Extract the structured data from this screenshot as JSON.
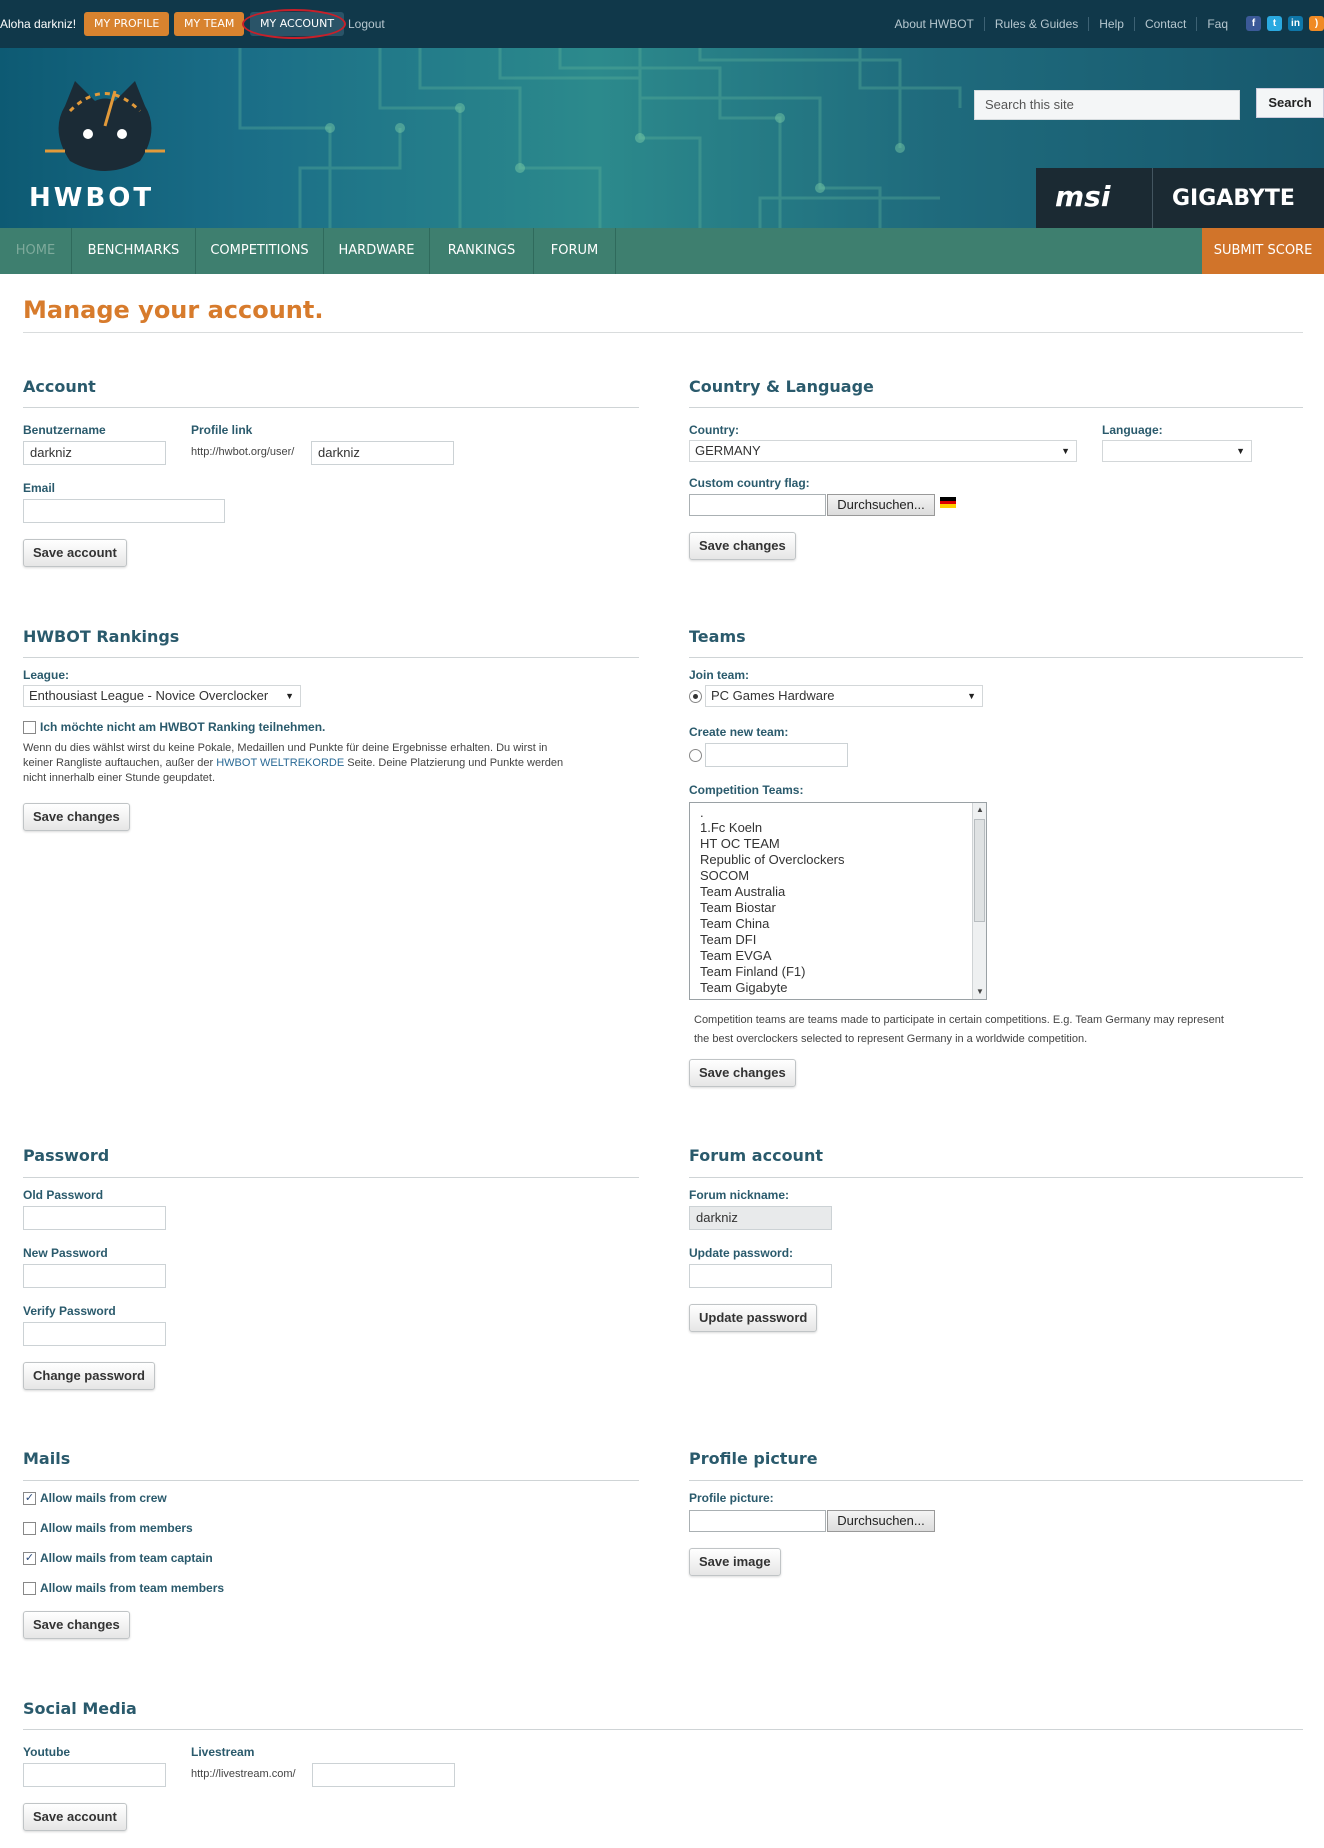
{
  "topbar": {
    "greeting": "Aloha darkniz!",
    "my_profile": "MY PROFILE",
    "my_team": "MY TEAM",
    "my_account": "MY ACCOUNT",
    "logout": "Logout",
    "links": [
      "About HWBOT",
      "Rules & Guides",
      "Help",
      "Contact",
      "Faq"
    ],
    "social_icons": [
      "facebook-icon",
      "twitter-icon",
      "linkedin-icon",
      "rss-icon"
    ]
  },
  "header": {
    "logo_text": "HWBOT",
    "search_placeholder": "Search this site",
    "search_button": "Search",
    "sponsors": [
      "msi",
      "GIGABYTE"
    ]
  },
  "nav": {
    "items": [
      "HOME",
      "BENCHMARKS",
      "COMPETITIONS",
      "HARDWARE",
      "RANKINGS",
      "FORUM"
    ],
    "submit": "SUBMIT SCORE"
  },
  "page_title": "Manage your account.",
  "account": {
    "title": "Account",
    "username_label": "Benutzername",
    "username_value": "darkniz",
    "profile_link_label": "Profile link",
    "profile_link_prefix": "http://hwbot.org/user/",
    "profile_link_value": "darkniz",
    "email_label": "Email",
    "email_value": "",
    "save_button": "Save account"
  },
  "country": {
    "title": "Country & Language",
    "country_label": "Country:",
    "country_value": "GERMANY",
    "language_label": "Language:",
    "language_value": "",
    "flag_label": "Custom country flag:",
    "browse_button": "Durchsuchen...",
    "save_button": "Save changes"
  },
  "rankings": {
    "title": "HWBOT Rankings",
    "league_label": "League:",
    "league_value": "Enthousiast League - Novice Overclocker",
    "optout_label": "Ich möchte nicht am HWBOT Ranking teilnehmen.",
    "note_line1": "Wenn du dies wählst wirst du keine Pokale, Medaillen und Punkte für deine Ergebnisse erhalten. Du wirst in",
    "note_line2_pre": "keiner Rangliste auftauchen, außer der",
    "note_line2_link": "HWBOT WELTREKORDE",
    "note_line2_post": "Seite. Deine Platzierung und Punkte werden",
    "note_line3": "nicht innerhalb einer Stunde geupdatet.",
    "save_button": "Save changes"
  },
  "teams": {
    "title": "Teams",
    "join_label": "Join team:",
    "join_value": "PC Games Hardware",
    "create_label": "Create new team:",
    "competition_label": "Competition Teams:",
    "competition_teams": [
      ".",
      "1.Fc Koeln",
      "HT OC TEAM",
      "Republic of Overclockers",
      "SOCOM",
      "Team Australia",
      "Team Biostar",
      "Team China",
      "Team DFI",
      "Team EVGA",
      "Team Finland (F1)",
      "Team Gigabyte"
    ],
    "note_line1": "Competition teams are teams made to participate in certain competitions. E.g. Team Germany may represent",
    "note_line2": "the best overclockers selected to represent Germany in a worldwide competition.",
    "save_button": "Save changes"
  },
  "password": {
    "title": "Password",
    "old_label": "Old Password",
    "new_label": "New Password",
    "verify_label": "Verify Password",
    "button": "Change password"
  },
  "forum": {
    "title": "Forum account",
    "nickname_label": "Forum nickname:",
    "nickname_value": "darkniz",
    "update_label": "Update password:",
    "button": "Update password"
  },
  "mails": {
    "title": "Mails",
    "options": [
      {
        "label": "Allow mails from crew",
        "checked": "✓"
      },
      {
        "label": "Allow mails from members",
        "checked": ""
      },
      {
        "label": "Allow mails from team captain",
        "checked": "✓"
      },
      {
        "label": "Allow mails from team members",
        "checked": ""
      }
    ],
    "save_button": "Save changes"
  },
  "picture": {
    "title": "Profile picture",
    "label": "Profile picture:",
    "browse_button": "Durchsuchen...",
    "save_button": "Save image"
  },
  "social": {
    "title": "Social Media",
    "youtube_label": "Youtube",
    "livestream_label": "Livestream",
    "livestream_prefix": "http://livestream.com/",
    "save_button": "Save account"
  },
  "colors": {
    "topbar": "#10384a",
    "accent_orange": "#d8832f",
    "nav_green": "#3e7f6f",
    "section_title": "#2a5a6c",
    "page_title": "#d77b2c"
  }
}
